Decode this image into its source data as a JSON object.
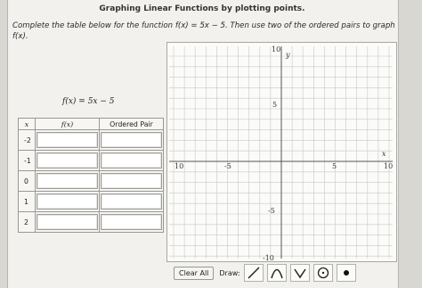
{
  "header": {
    "title": "Graphing Linear Functions by plotting points."
  },
  "instructions": {
    "line1": "Complete the table below for the function f(x) = 5x − 5. Then use two of the ordered pairs to graph",
    "line2": "f(x)."
  },
  "function_caption": "f(x) = 5x − 5",
  "table": {
    "headers": [
      "x",
      "f(x)",
      "Ordered Pair"
    ],
    "rows": [
      {
        "x": "-2",
        "fx": "",
        "pair": ""
      },
      {
        "x": "-1",
        "fx": "",
        "pair": ""
      },
      {
        "x": "0",
        "fx": "",
        "pair": ""
      },
      {
        "x": "1",
        "fx": "",
        "pair": ""
      },
      {
        "x": "2",
        "fx": "",
        "pair": ""
      }
    ]
  },
  "graph": {
    "tick_labels": {
      "x_neg": "10",
      "x_neg5": "-5",
      "x_pos5": "5",
      "x_pos": "10",
      "y_top": "10",
      "y_5": "5",
      "y_neg5": "-5",
      "y_bottom": "-10"
    },
    "axis_labels": {
      "x": "x",
      "y": "y"
    }
  },
  "toolbar": {
    "clear_label": "Clear All",
    "draw_label": "Draw:",
    "tools": [
      "line-tool-icon",
      "parabola-tool-icon",
      "absolute-value-tool-icon",
      "circle-tool-icon",
      "point-tool-icon"
    ]
  }
}
